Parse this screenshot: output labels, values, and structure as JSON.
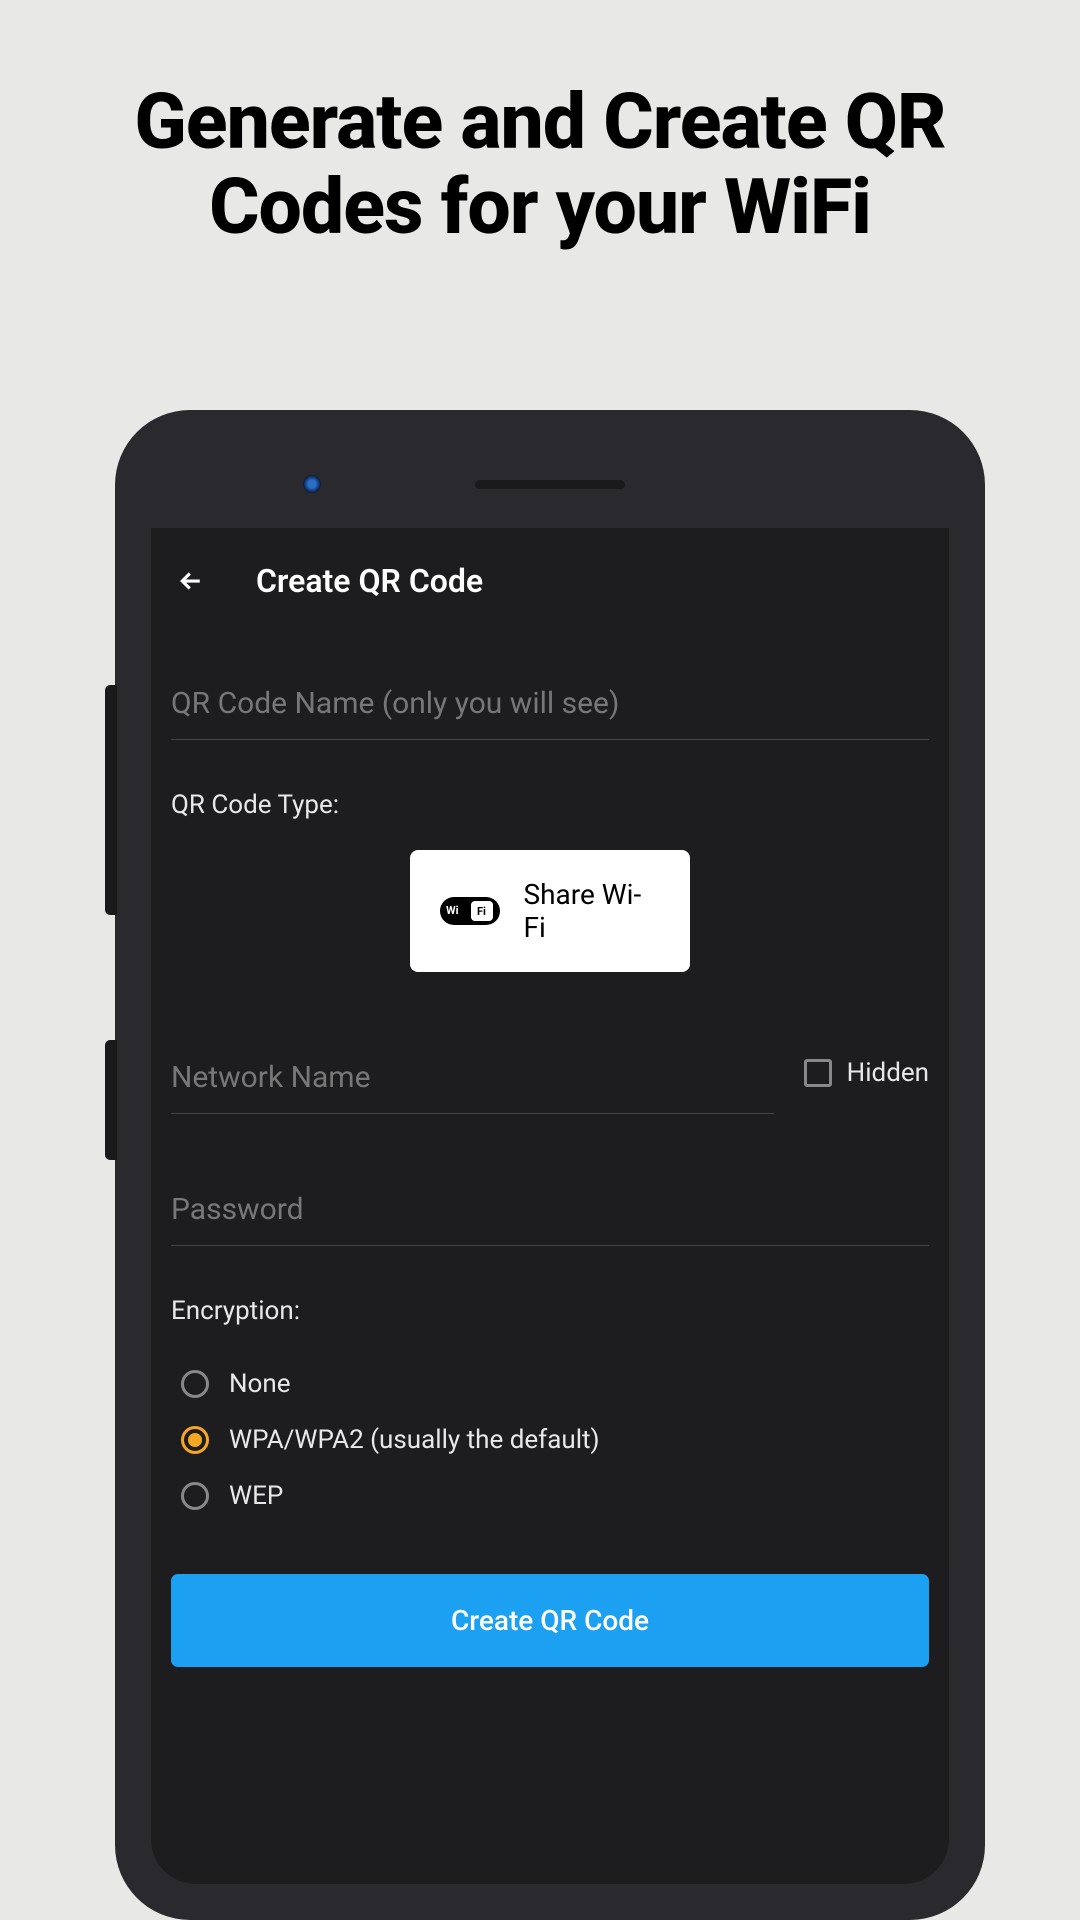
{
  "marketing": {
    "title": "Generate and Create QR Codes for your WiFi"
  },
  "appbar": {
    "title": "Create QR Code"
  },
  "form": {
    "qr_name_placeholder": "QR Code Name (only you will see)",
    "type_label": "QR Code Type:",
    "type_chip": "Share Wi-Fi",
    "network_placeholder": "Network Name",
    "hidden_label": "Hidden",
    "password_placeholder": "Password",
    "encryption_label": "Encryption:",
    "encryption_options": {
      "none": "None",
      "wpa": "WPA/WPA2 (usually the default)",
      "wep": "WEP"
    },
    "submit_label": "Create QR Code"
  }
}
